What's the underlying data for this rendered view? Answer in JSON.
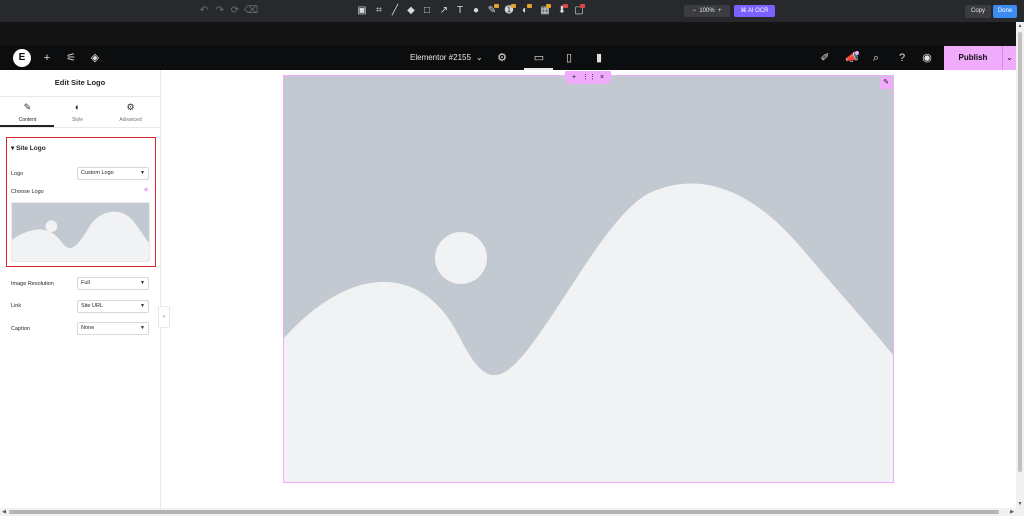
{
  "screenshot_toolbar": {
    "zoom": "100%",
    "zoom_minus": "−",
    "zoom_plus": "+",
    "ai_ocr_label": "AI OCR",
    "copy_label": "Copy",
    "done_label": "Done",
    "icons": [
      "undo-icon",
      "redo-icon",
      "redo-all-icon",
      "eraser-icon",
      "crop-full-icon",
      "crop-icon",
      "pen-icon",
      "marker-icon",
      "rectangle-icon",
      "arrow-icon",
      "text-icon",
      "fill-icon",
      "brush-icon",
      "step-icon",
      "blur-icon",
      "mosaic-icon",
      "pin-icon",
      "image-icon"
    ]
  },
  "editor_topbar": {
    "document_title": "Elementor #2155",
    "publish_label": "Publish"
  },
  "panel": {
    "title": "Edit Site Logo",
    "tabs": [
      {
        "label": "Content",
        "icon": "pencil-icon",
        "active": true
      },
      {
        "label": "Style",
        "icon": "half-circle-icon",
        "active": false
      },
      {
        "label": "Advanced",
        "icon": "gear-icon",
        "active": false
      }
    ],
    "section_title": "Site Logo",
    "logo_label": "Logo",
    "logo_value": "Custom Logo",
    "choose_logo_label": "Choose Logo",
    "image_resolution_label": "Image Resolution",
    "image_resolution_value": "Full",
    "link_label": "Link",
    "link_value": "Site URL",
    "caption_label": "Caption",
    "caption_value": "None"
  },
  "colors": {
    "accent": "#f0abfc",
    "placeholder_bg": "#c3c9d0",
    "placeholder_fg": "#f1f2f3",
    "highlight": "#d62828"
  }
}
